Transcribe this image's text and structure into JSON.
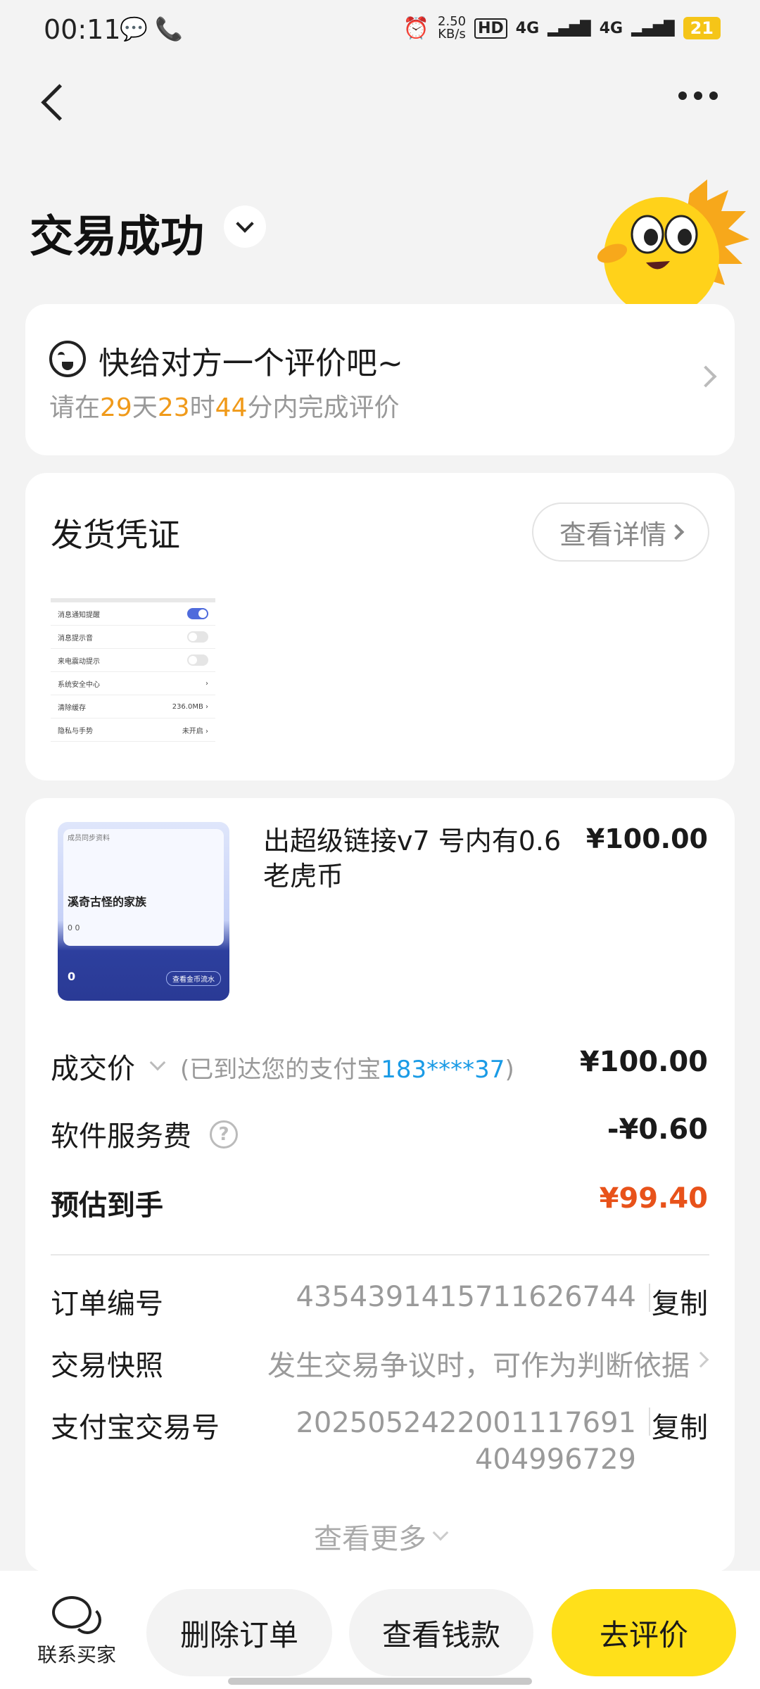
{
  "status_bar": {
    "time": "00:11",
    "left_icons": "💬 📞",
    "net_speed_value": "2.50",
    "net_speed_unit": "KB/s",
    "hd": "HD",
    "net1": "4G",
    "net2": "4G",
    "battery": "21"
  },
  "header": {
    "title": "交易成功"
  },
  "review_card": {
    "title": "快给对方一个评价吧~",
    "sub_prefix": "请在",
    "days": "29",
    "days_unit": "天",
    "hours": "23",
    "hours_unit": "时",
    "minutes": "44",
    "minutes_unit": "分内完成评价"
  },
  "proof_card": {
    "title": "发货凭证",
    "detail_button": "查看详情",
    "thumbnail_rows": [
      "消息通知提醒",
      "消息提示音",
      "来电震动提示",
      "系统安全中心",
      "清除缓存",
      "隐私与手势"
    ],
    "thumbnail_values": [
      "",
      "",
      "",
      "›",
      "236.0MB ›",
      "未开启 ›"
    ]
  },
  "order": {
    "product_title": "出超级链接v7 号内有0.6老虎币",
    "product_price": "¥100.00",
    "product_image": {
      "header": "成员同步资料",
      "family_name": "溪奇古怪的家族",
      "stats": "0    0",
      "currency": "0",
      "button": "查看金币流水"
    },
    "deal_label": "成交价",
    "deal_note_prefix": "(已到达您的支付宝",
    "deal_account": "183****37",
    "deal_note_suffix": ")",
    "deal_value": "¥100.00",
    "fee_label": "软件服务费",
    "fee_value": "-¥0.60",
    "estimate_label": "预估到手",
    "estimate_value": "¥99.40",
    "order_no_label": "订单编号",
    "order_no_value": "4354391415711626744",
    "copy_label": "复制",
    "snapshot_label": "交易快照",
    "snapshot_value": "发生交易争议时，可作为判断依据",
    "alipay_label": "支付宝交易号",
    "alipay_value": "2025052422001117691404996729",
    "see_more": "查看更多"
  },
  "bottom_bar": {
    "contact_label": "联系买家",
    "delete_button": "删除订单",
    "funds_button": "查看钱款",
    "review_button": "去评价"
  },
  "colors": {
    "accent_yellow": "#ffe01a",
    "countdown_orange": "#f09a1a",
    "link_blue": "#1a9be6",
    "price_red": "#e8521a"
  }
}
